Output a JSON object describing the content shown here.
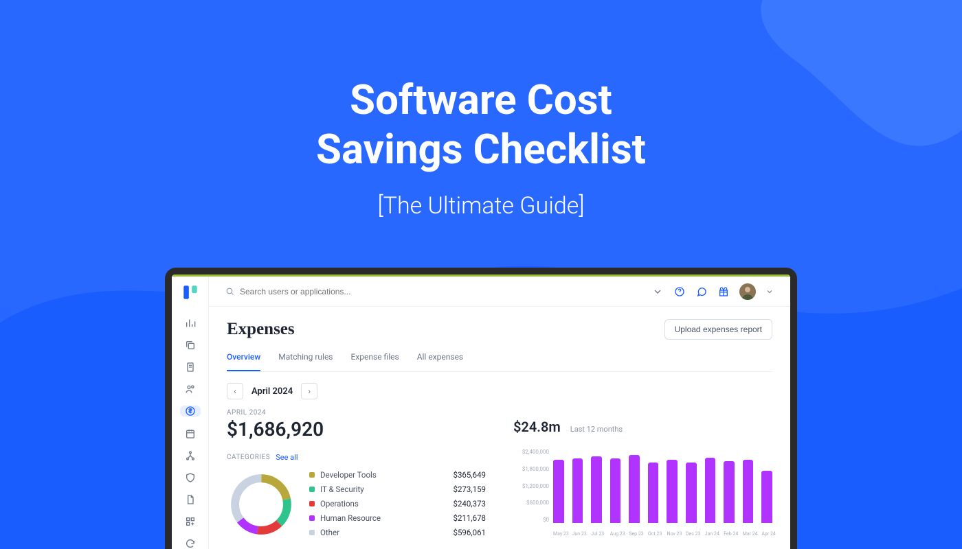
{
  "hero": {
    "title_line1": "Software Cost",
    "title_line2": "Savings Checklist",
    "subtitle": "[The Ultimate Guide]"
  },
  "search": {
    "placeholder": "Search users or applications..."
  },
  "page": {
    "title": "Expenses"
  },
  "upload_label": "Upload expenses report",
  "tabs": [
    {
      "label": "Overview",
      "active": true
    },
    {
      "label": "Matching rules",
      "active": false
    },
    {
      "label": "Expense files",
      "active": false
    },
    {
      "label": "All expenses",
      "active": false
    }
  ],
  "month_picker": {
    "label": "April 2024"
  },
  "summary": {
    "period_label": "APRIL 2024",
    "amount": "$1,686,920",
    "categories_label": "CATEGORIES",
    "see_all": "See all"
  },
  "categories": [
    {
      "name": "Developer Tools",
      "value": "$365,649",
      "color": "#b8a73a"
    },
    {
      "name": "IT & Security",
      "value": "$273,159",
      "color": "#2fc48d"
    },
    {
      "name": "Operations",
      "value": "$240,373",
      "color": "#e33b3b"
    },
    {
      "name": "Human Resource",
      "value": "$211,678",
      "color": "#b033ff"
    },
    {
      "name": "Other",
      "value": "$596,061",
      "color": "#c8d2e0"
    }
  ],
  "trend": {
    "amount": "$24.8m",
    "period": "Last 12 months"
  },
  "chart_data": {
    "type": "bar",
    "title": "",
    "ylabel": "",
    "xlabel": "",
    "ylim": [
      0,
      2400000
    ],
    "y_ticks": [
      "$2,400,000",
      "$1,800,000",
      "$1,200,000",
      "$600,000",
      "$0"
    ],
    "categories": [
      "May 23",
      "Jun 23",
      "Jul 23",
      "Aug 23",
      "Sep 23",
      "Oct 23",
      "Nov 23",
      "Dec 23",
      "Jan 24",
      "Feb 24",
      "Mar 24",
      "Apr 24"
    ],
    "values": [
      2050000,
      2080000,
      2150000,
      2080000,
      2200000,
      1950000,
      2050000,
      1950000,
      2120000,
      2000000,
      2050000,
      1700000
    ]
  },
  "colors": {
    "brand": "#1a5dff",
    "chart_bar": "#b033ff"
  }
}
